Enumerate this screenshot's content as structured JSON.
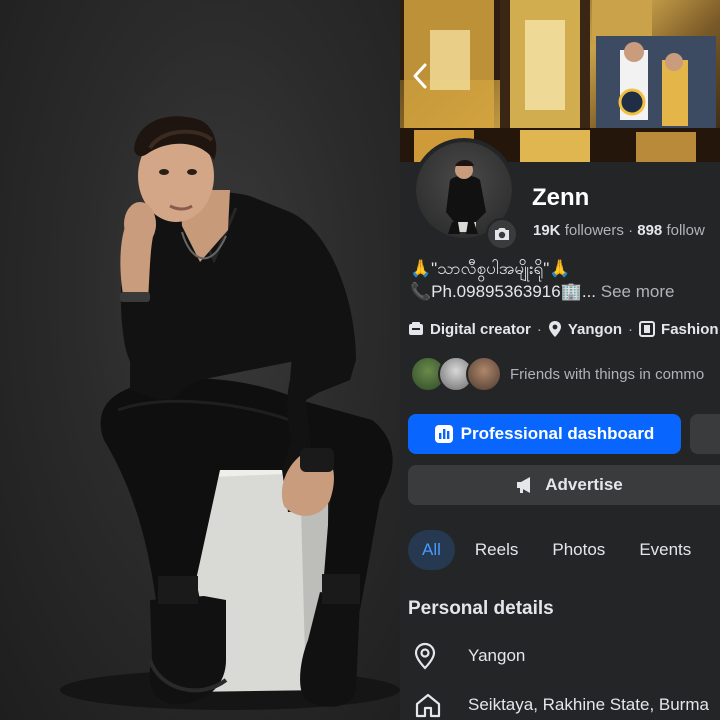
{
  "profile": {
    "name": "Zenn",
    "followers_count": "19K",
    "followers_label": "followers",
    "following_count": "898",
    "following_label": "follow",
    "bio_line1": "🙏\"သာလီစွပါအမျိုးရို\"🙏",
    "bio_line2": "📞Ph.09895363916🏢...",
    "see_more": "See more",
    "category": "Digital creator",
    "location": "Yangon",
    "interest": "Fashion",
    "friends_text": "Friends with things in commo"
  },
  "buttons": {
    "professional_dashboard": "Professional dashboard",
    "advertise": "Advertise"
  },
  "tabs": [
    {
      "label": "All",
      "active": true
    },
    {
      "label": "Reels",
      "active": false
    },
    {
      "label": "Photos",
      "active": false
    },
    {
      "label": "Events",
      "active": false
    }
  ],
  "personal_details": {
    "title": "Personal details",
    "items": [
      {
        "icon": "location-pin-icon",
        "text": "Yangon"
      },
      {
        "icon": "home-icon",
        "text": "Seiktaya, Rakhine State, Burma"
      }
    ]
  },
  "colors": {
    "accent": "#0866ff",
    "active_tab_bg": "#263951",
    "active_tab_text": "#4599ff",
    "panel_bg": "#242526"
  }
}
